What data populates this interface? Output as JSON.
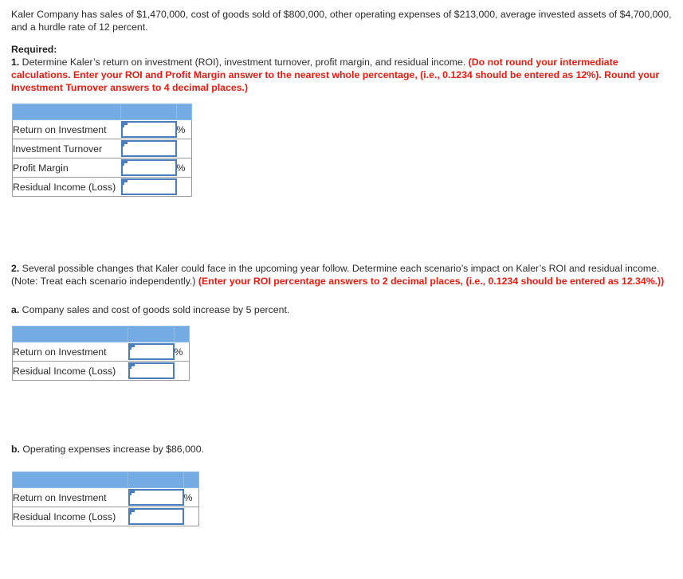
{
  "problem": {
    "intro": "Kaler Company has sales of $1,470,000, cost of goods sold of $800,000, other operating expenses of $213,000, average invested assets of $4,700,000, and a hurdle rate of 12 percent.",
    "required_label": "Required:",
    "q1": {
      "number": "1.",
      "text": " Determine Kaler’s return on investment (ROI), investment turnover, profit margin, and residual income. ",
      "instruction_red": "(Do not round your intermediate calculations. Enter your ROI and Profit Margin answer to the nearest whole percentage, (i.e., 0.1234 should be entered as 12%). Round your Investment Turnover answers to 4 decimal places.)"
    },
    "q2": {
      "number": "2.",
      "text": " Several possible changes that Kaler could face in the upcoming year follow. Determine each scenario’s impact on Kaler’s ROI and residual income. (Note: Treat each scenario independently.) ",
      "instruction_red": "(Enter your ROI percentage answers to 2 decimal places, (i.e., 0.1234 should be entered as 12.34%.))"
    },
    "scenario_a": {
      "letter": "a.",
      "text": " Company sales and cost of goods sold increase by 5 percent."
    },
    "scenario_b": {
      "letter": "b.",
      "text": " Operating expenses increase by $86,000."
    }
  },
  "tables": {
    "t1": {
      "header": [
        "",
        "",
        ""
      ],
      "rows": [
        {
          "label": "Return on Investment",
          "value": "",
          "unit": "%"
        },
        {
          "label": "Investment Turnover",
          "value": "",
          "unit": ""
        },
        {
          "label": "Profit Margin",
          "value": "",
          "unit": "%"
        },
        {
          "label": "Residual Income (Loss)",
          "value": "",
          "unit": ""
        }
      ]
    },
    "t2": {
      "header": [
        "",
        "",
        ""
      ],
      "rows": [
        {
          "label": "Return on Investment",
          "value": "",
          "unit": "%"
        },
        {
          "label": "Residual Income (Loss)",
          "value": "",
          "unit": ""
        }
      ]
    },
    "t3": {
      "header": [
        "",
        "",
        ""
      ],
      "rows": [
        {
          "label": "Return on Investment",
          "value": "",
          "unit": "%"
        },
        {
          "label": "Residual Income (Loss)",
          "value": "",
          "unit": ""
        }
      ]
    }
  },
  "colors": {
    "header_blue": "#74abe3",
    "input_border_blue": "#4a7ebb",
    "instruction_red": "#e81b0e",
    "grid_gray": "#9b9b9b"
  }
}
